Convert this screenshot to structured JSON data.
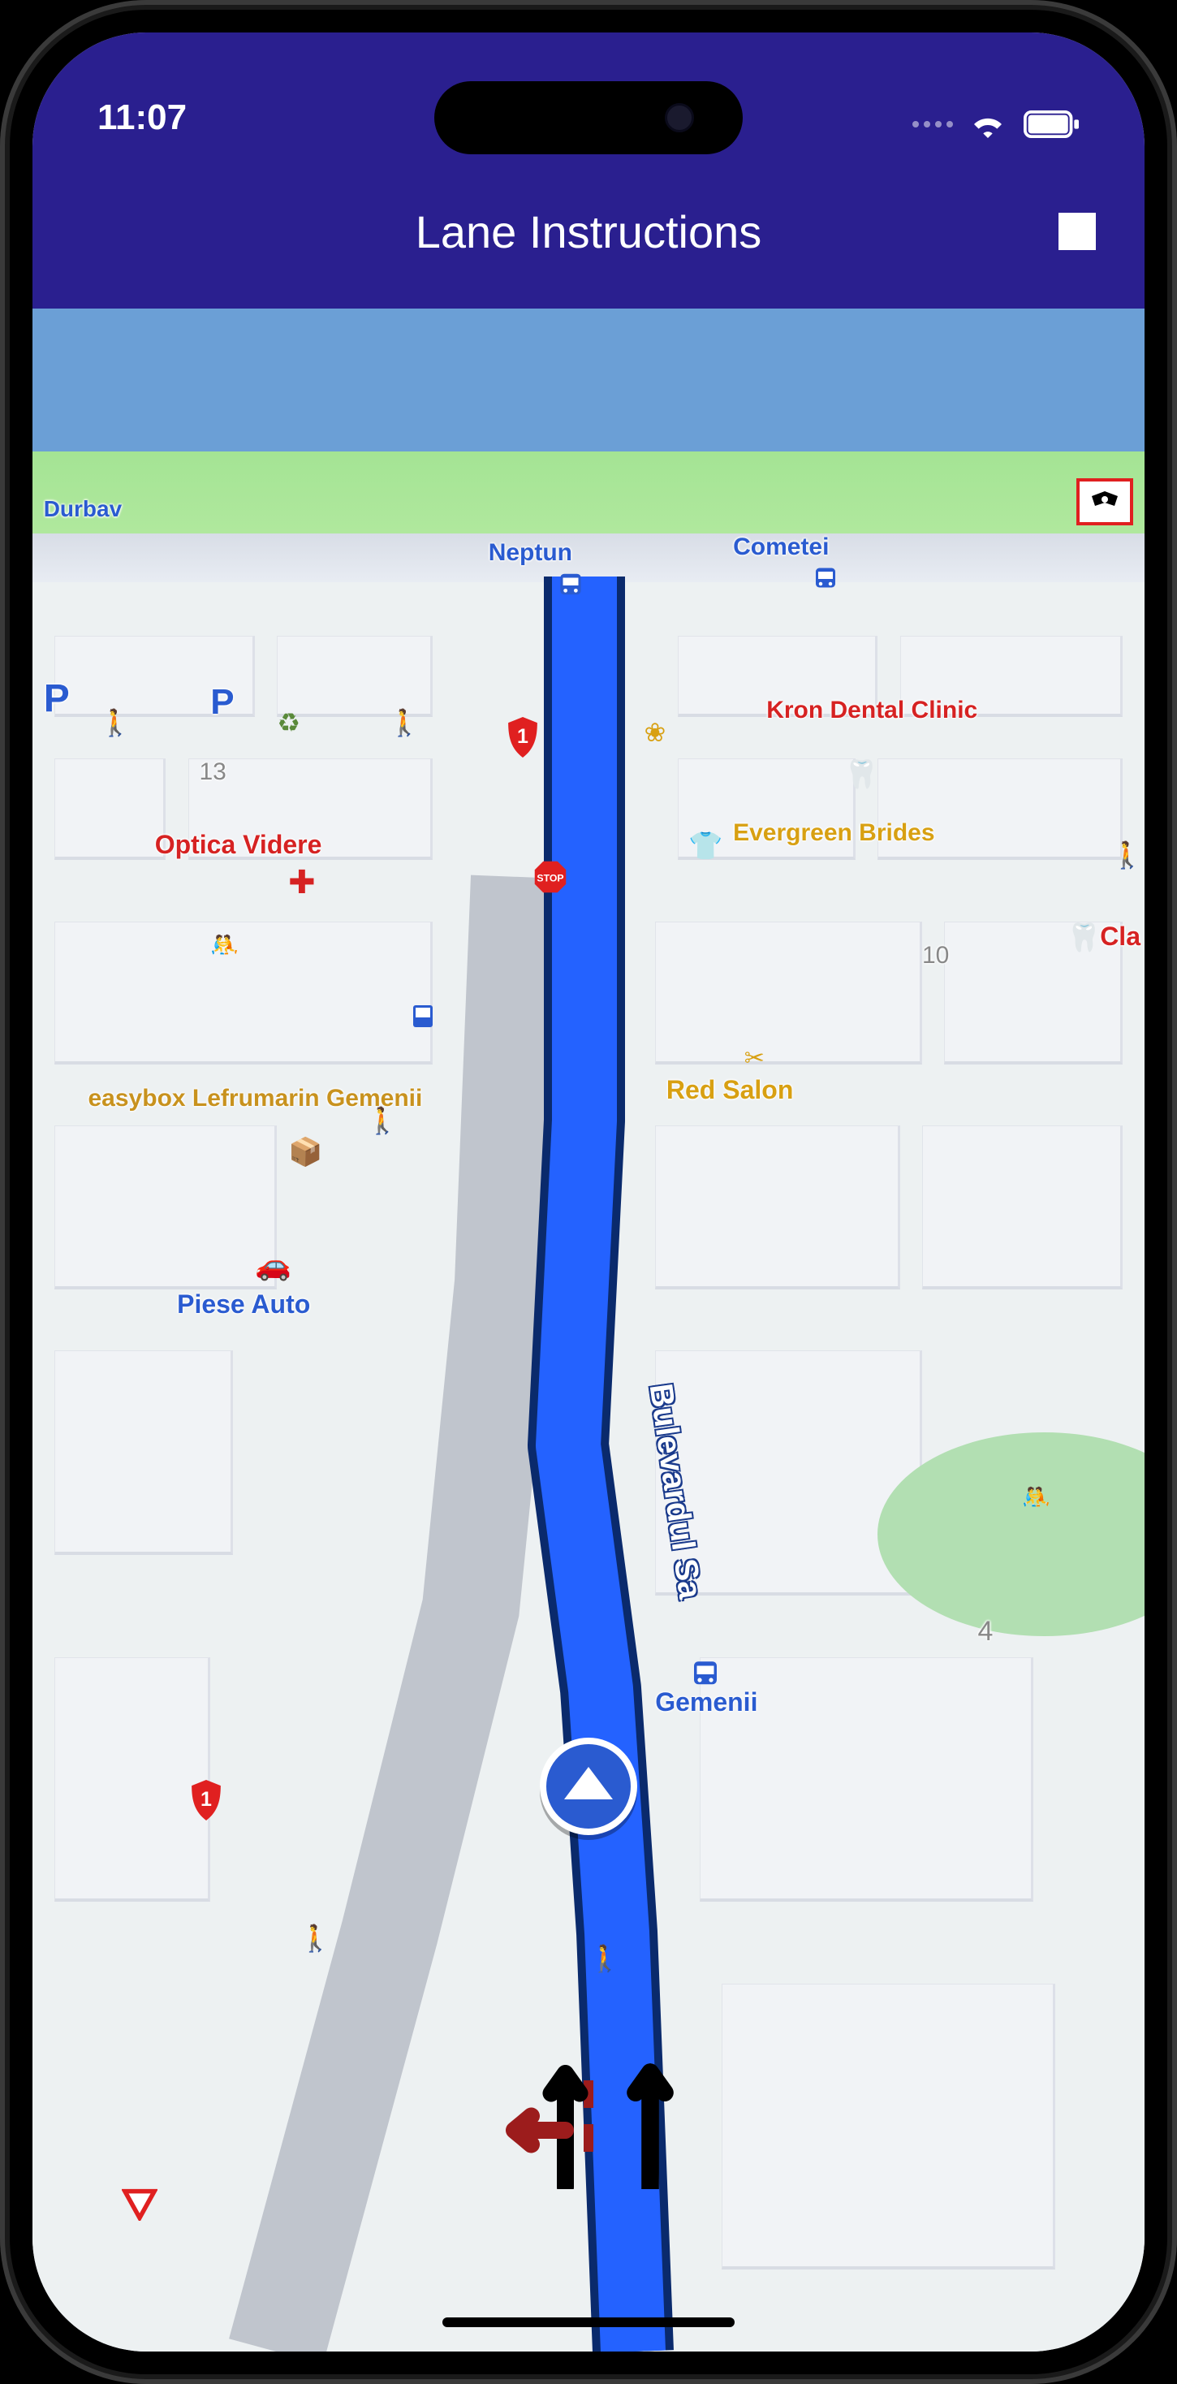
{
  "status": {
    "time": "11:07"
  },
  "header": {
    "title": "Lane Instructions"
  },
  "map": {
    "street_name": "Bulevardul Sa",
    "labels": {
      "durbav": "Durbav",
      "neptun": "Neptun",
      "cometei": "Cometei",
      "kron_dental": "Kron Dental Clinic",
      "optica_videre": "Optica Videre",
      "evergreen_brides": "Evergreen Brides",
      "cla": "Cla",
      "red_salon": "Red Salon",
      "easybox": "easybox Lefrumarin Gemenii",
      "piese_auto": "Piese Auto",
      "gemenii": "Gemenii",
      "house_13": "13",
      "house_10": "10",
      "house_4": "4"
    },
    "route_shield": "1",
    "stop_sign": "STOP",
    "parking": "P"
  },
  "lanes": {
    "lane1": "left-and-straight",
    "lane2": "straight",
    "active_hint": "left-lane-highlighted"
  },
  "colors": {
    "header_bg": "#2a1f8f",
    "route": "#2462ff",
    "poi_red": "#d62222",
    "poi_blue": "#2a5bd0",
    "poi_orange": "#d8a012"
  }
}
